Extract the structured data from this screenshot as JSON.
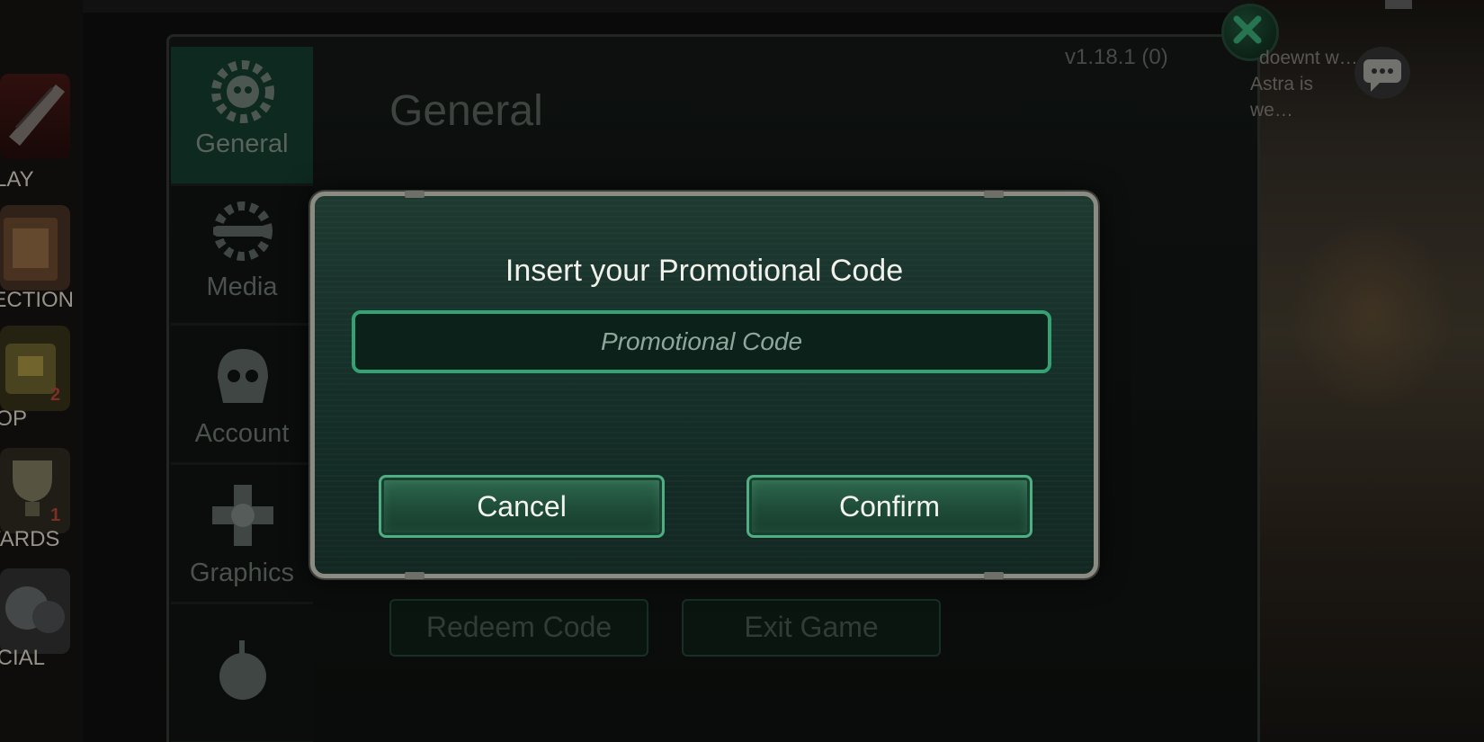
{
  "nav": {
    "items": [
      {
        "label": "PLAY"
      },
      {
        "label": "LECTION"
      },
      {
        "label": "HOP",
        "badge": "2"
      },
      {
        "label": "WARDS",
        "badge": "1"
      },
      {
        "label": "OCIAL"
      }
    ]
  },
  "settings": {
    "version": "v1.18.1 (0)",
    "heading": "General",
    "tabs": [
      {
        "label": "General",
        "icon": "cog-skull-icon",
        "active": true
      },
      {
        "label": "Media",
        "icon": "wrench-cog-icon"
      },
      {
        "label": "Account",
        "icon": "helmet-icon"
      },
      {
        "label": "Graphics",
        "icon": "skull-cross-icon"
      },
      {
        "label": "",
        "icon": "cyborg-skull-icon"
      }
    ],
    "redeem_label": "Redeem Code",
    "exit_label": "Exit Game"
  },
  "chat": {
    "line1": "doewnt w…",
    "line2": "Astra is we…"
  },
  "modal": {
    "title": "Insert your Promotional Code",
    "placeholder": "Promotional Code",
    "cancel_label": "Cancel",
    "confirm_label": "Confirm"
  },
  "colors": {
    "accent": "#35a276",
    "button_bg": "#1e4b38",
    "modal_border": "#8b8b83"
  }
}
